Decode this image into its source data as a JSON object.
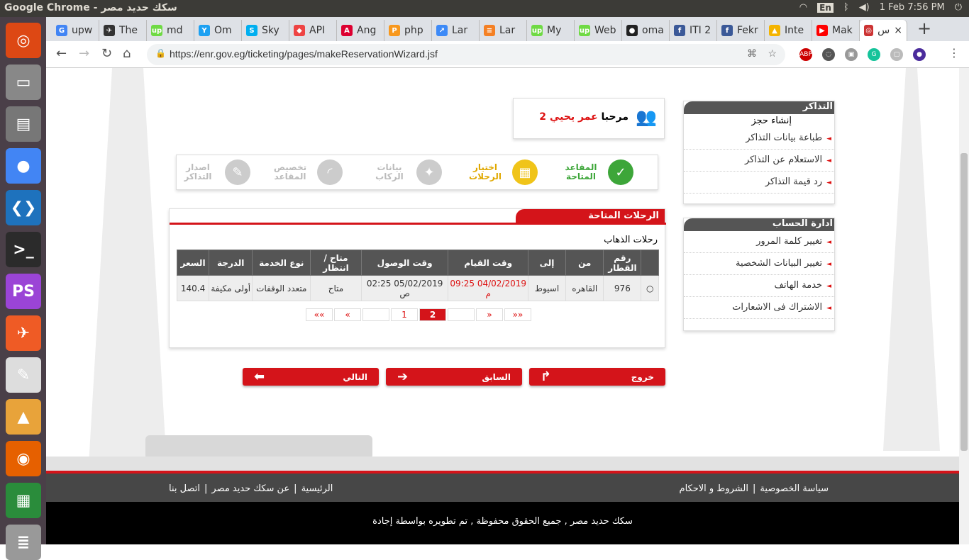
{
  "os": {
    "window_title": "Google Chrome - سكك حديد مصر",
    "keyboard": "En",
    "datetime": "1 Feb  7:56 PM"
  },
  "launcher": [
    {
      "name": "ubuntu-icon",
      "color": "#dd4814",
      "glyph": "◎"
    },
    {
      "name": "files-drive-icon",
      "color": "#888",
      "glyph": "▭"
    },
    {
      "name": "file-manager-icon",
      "color": "#777",
      "glyph": "▤"
    },
    {
      "name": "chrome-icon",
      "color": "#4285f4",
      "glyph": "●"
    },
    {
      "name": "vscode-icon",
      "color": "#1e72bd",
      "glyph": "❮❯"
    },
    {
      "name": "terminal-icon",
      "color": "#2b2b2b",
      "glyph": ">_"
    },
    {
      "name": "phpstorm-icon",
      "color": "#9b44d6",
      "glyph": "PS"
    },
    {
      "name": "postman-icon",
      "color": "#ef5b25",
      "glyph": "✈"
    },
    {
      "name": "text-editor-icon",
      "color": "#ddd",
      "glyph": "✎"
    },
    {
      "name": "presentation-icon",
      "color": "#e8a33a",
      "glyph": "▲"
    },
    {
      "name": "firefox-icon",
      "color": "#e66000",
      "glyph": "◉"
    },
    {
      "name": "spreadsheet-icon",
      "color": "#2a8c3b",
      "glyph": "▦"
    },
    {
      "name": "workspaces-icon",
      "color": "#999",
      "glyph": "≣"
    }
  ],
  "tabs": [
    {
      "label": "upw",
      "fav": "G",
      "color": "#4285f4"
    },
    {
      "label": "The",
      "fav": "✈",
      "color": "#333"
    },
    {
      "label": "md",
      "fav": "up",
      "color": "#6fda44"
    },
    {
      "label": "Om",
      "fav": "Y",
      "color": "#1da1f2"
    },
    {
      "label": "Sky",
      "fav": "S",
      "color": "#00aff0"
    },
    {
      "label": "API",
      "fav": "◆",
      "color": "#e44"
    },
    {
      "label": "Ang",
      "fav": "A",
      "color": "#dd0031"
    },
    {
      "label": "php",
      "fav": "P",
      "color": "#f8981d"
    },
    {
      "label": "Lar",
      "fav": "↗",
      "color": "#3d8af7"
    },
    {
      "label": "Lar",
      "fav": "≡",
      "color": "#f48024"
    },
    {
      "label": "My",
      "fav": "up",
      "color": "#6fda44"
    },
    {
      "label": "Web",
      "fav": "up",
      "color": "#6fda44"
    },
    {
      "label": "oma",
      "fav": "●",
      "color": "#222"
    },
    {
      "label": "ITI 2",
      "fav": "f",
      "color": "#3b5998"
    },
    {
      "label": "Fekr",
      "fav": "f",
      "color": "#3b5998"
    },
    {
      "label": "Inte",
      "fav": "▲",
      "color": "#f4b400"
    },
    {
      "label": "Mak",
      "fav": "▶",
      "color": "#f00"
    },
    {
      "label": "س",
      "fav": "◎",
      "color": "#c33"
    }
  ],
  "url": "https://enr.gov.eg/ticketing/pages/makeReservationWizard.jsf",
  "extensions": [
    {
      "name": "abp-icon",
      "t": "ABP",
      "c": "#c00"
    },
    {
      "name": "ext-circle-icon",
      "t": "◌",
      "c": "#555"
    },
    {
      "name": "ext-robot-icon",
      "t": "▣",
      "c": "#999"
    },
    {
      "name": "grammarly-icon",
      "t": "G",
      "c": "#15c39a"
    },
    {
      "name": "ext-box-icon",
      "t": "▢",
      "c": "#bbb"
    },
    {
      "name": "profile-icon",
      "t": "●",
      "c": "#4b2c9c"
    }
  ],
  "tickets_menu": {
    "title": "التذاكر",
    "create": "إنشاء حجز",
    "items": [
      "طباعة بيانات التذاكر",
      "الاستعلام عن التذاكر",
      "رد قيمة التذاكر"
    ]
  },
  "account_menu": {
    "title": "ادارة الحساب",
    "items": [
      "تغيير كلمة المرور",
      "تغيير البيانات الشخصية",
      "خدمة الهاتف",
      "الاشتراك فى الاشعارات"
    ]
  },
  "welcome": {
    "greeting": "مرحبا",
    "name": "عمر يحيي 2"
  },
  "steps": [
    {
      "label": "المقاعد المتاحة",
      "state": "done",
      "color": "#3da639",
      "glyph": "✓"
    },
    {
      "label": "اختيار الرحلات",
      "state": "active",
      "color": "#f0c419",
      "glyph": "▦"
    },
    {
      "label": "بيانات الركاب",
      "state": "pending",
      "color": "#ccc",
      "glyph": "✦"
    },
    {
      "label": "تخصيص المقاعد",
      "state": "pending",
      "color": "#ccc",
      "glyph": "◜"
    },
    {
      "label": "اصدار التذاكر",
      "state": "pending",
      "color": "#ccc",
      "glyph": "✎"
    }
  ],
  "trips": {
    "title": "الرحلات المتاحة",
    "subtitle": "رحلات الذهاب",
    "columns": [
      "",
      "رقم القطار",
      "من",
      "إلى",
      "وقت القيام",
      "وقت الوصول",
      "متاح / انتظار",
      "نوع الخدمة",
      "الدرجة",
      "السعر"
    ],
    "rows": [
      {
        "train": "976",
        "from": "القاهره",
        "to": "اسيوط",
        "depart": "04/02/2019 09:25 م",
        "arrive": "05/02/2019 02:25 ص",
        "status": "متاح",
        "service": "متعدد الوقفات",
        "class": "أولى مكيفة",
        "price": "140.4"
      }
    ],
    "pager": [
      "««",
      "«",
      "",
      "1",
      "2",
      "",
      "»",
      "»»"
    ],
    "current_page": "2"
  },
  "buttons": {
    "exit": "خروج",
    "prev": "السابق",
    "next": "التالي"
  },
  "footer": {
    "links_right": [
      "سياسة الخصوصية",
      "|",
      "الشروط و الاحكام"
    ],
    "links_left": [
      "الرئيسية",
      "|",
      "عن سكك حديد مصر",
      "|",
      "اتصل بنا"
    ],
    "copyright": "سكك حديد مصر , جميع الحقوق محفوظة , تم تطويره بواسطة إجادة"
  },
  "colors": {
    "accent": "#d4141a",
    "active_step": "#f0c419",
    "done_step": "#3da639"
  }
}
